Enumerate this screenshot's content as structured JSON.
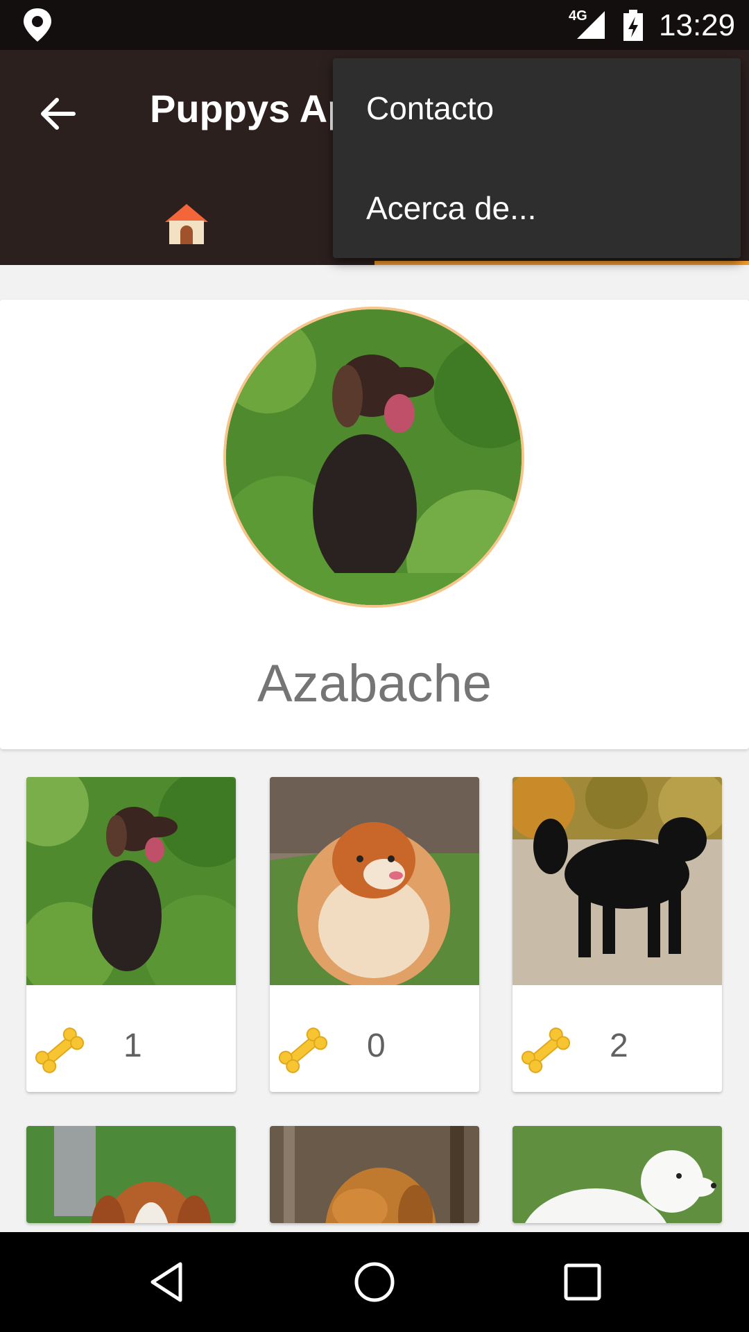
{
  "status_bar": {
    "network": "4G",
    "time": "13:29"
  },
  "app_bar": {
    "title": "Puppys App"
  },
  "menu": {
    "items": [
      {
        "label": "Contacto"
      },
      {
        "label": "Acerca de..."
      }
    ]
  },
  "profile": {
    "name": "Azabache"
  },
  "pets": [
    {
      "likes": "1"
    },
    {
      "likes": "0"
    },
    {
      "likes": "2"
    }
  ],
  "colors": {
    "accent": "#f59a2b",
    "app_bar": "#2c201f",
    "menu": "#2e2e2e"
  }
}
